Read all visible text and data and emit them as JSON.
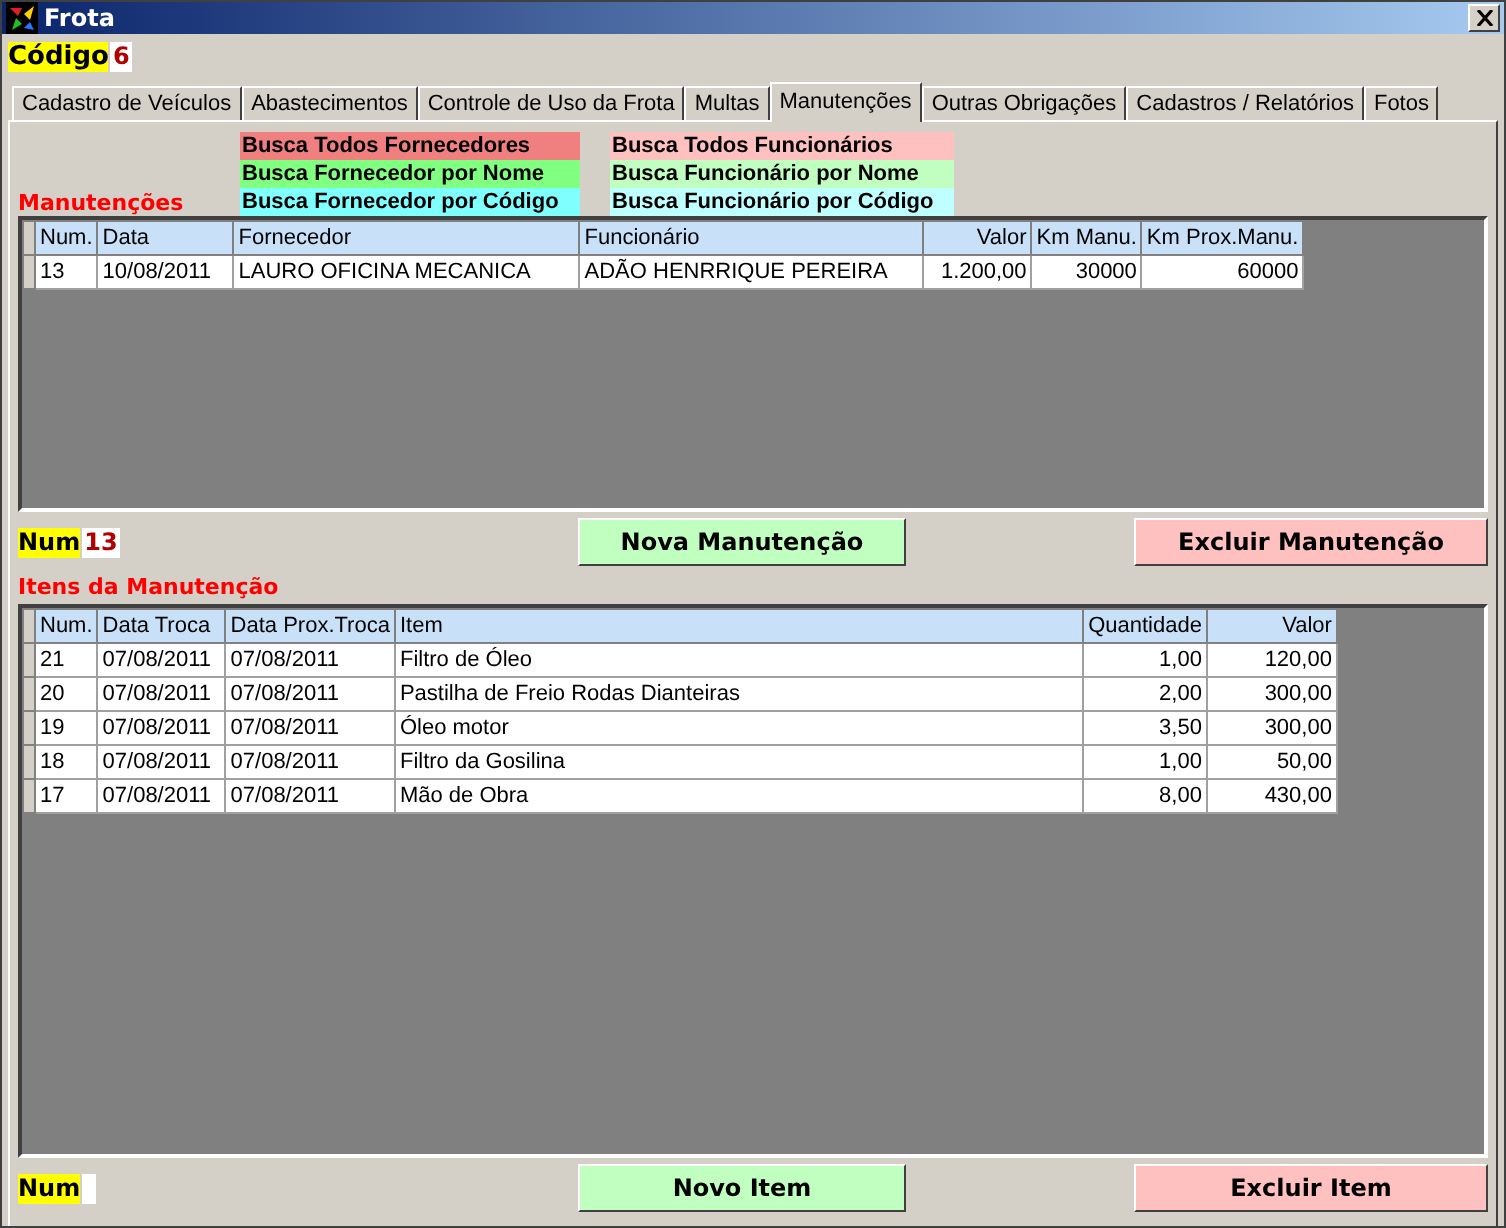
{
  "window": {
    "title": "Frota"
  },
  "codigo": {
    "label": "Código",
    "value": "6"
  },
  "tabs": [
    {
      "label": "Cadastro de Veículos",
      "selected": false
    },
    {
      "label": "Abastecimentos",
      "selected": false
    },
    {
      "label": "Controle de Uso da Frota",
      "selected": false
    },
    {
      "label": "Multas",
      "selected": false
    },
    {
      "label": "Manutenções",
      "selected": true
    },
    {
      "label": "Outras Obrigações",
      "selected": false
    },
    {
      "label": "Cadastros / Relatórios",
      "selected": false
    },
    {
      "label": "Fotos",
      "selected": false
    }
  ],
  "search_buttons": [
    {
      "label": "Busca Todos Fornecedores",
      "color": "#f08080"
    },
    {
      "label": "Busca Todos Funcionários",
      "color": "#ffc0c0"
    },
    {
      "label": "Busca Fornecedor por Nome",
      "color": "#80ff80"
    },
    {
      "label": "Busca Funcionário por Nome",
      "color": "#c0ffc0"
    },
    {
      "label": "Busca Fornecedor por Código",
      "color": "#80ffff"
    },
    {
      "label": "Busca Funcionário por Código",
      "color": "#c0ffff"
    }
  ],
  "manutencoes": {
    "title": "Manutenções",
    "columns": [
      "Num.",
      "Data",
      "Fornecedor",
      "Funcionário",
      "Valor",
      "Km Manu.",
      "Km Prox.Manu."
    ],
    "rows": [
      [
        "13",
        "10/08/2011",
        "LAURO OFICINA MECANICA",
        "ADÃO HENRRIQUE PEREIRA",
        "1.200,00",
        "30000",
        "60000"
      ]
    ],
    "num": {
      "label": "Num",
      "value": "13"
    },
    "buttons": [
      {
        "label": "Nova Manutenção",
        "color": "#c0ffc0"
      },
      {
        "label": "Excluir Manutenção",
        "color": "#ffc0c0"
      }
    ]
  },
  "itens": {
    "title": "Itens da Manutenção",
    "columns": [
      "Num.",
      "Data Troca",
      "Data Prox.Troca",
      "Item",
      "Quantidade",
      "Valor"
    ],
    "rows": [
      [
        "21",
        "07/08/2011",
        "07/08/2011",
        "Filtro de Óleo",
        "1,00",
        "120,00"
      ],
      [
        "20",
        "07/08/2011",
        "07/08/2011",
        "Pastilha de Freio Rodas Dianteiras",
        "2,00",
        "300,00"
      ],
      [
        "19",
        "07/08/2011",
        "07/08/2011",
        "Óleo motor",
        "3,50",
        "300,00"
      ],
      [
        "18",
        "07/08/2011",
        "07/08/2011",
        "Filtro da Gosilina",
        "1,00",
        "50,00"
      ],
      [
        "17",
        "07/08/2011",
        "07/08/2011",
        "Mão de Obra",
        "8,00",
        "430,00"
      ]
    ],
    "num": {
      "label": "Num"
    },
    "buttons": [
      {
        "label": "Novo Item",
        "color": "#c0ffc0"
      },
      {
        "label": "Excluir Item",
        "color": "#ffc0c0"
      }
    ]
  }
}
